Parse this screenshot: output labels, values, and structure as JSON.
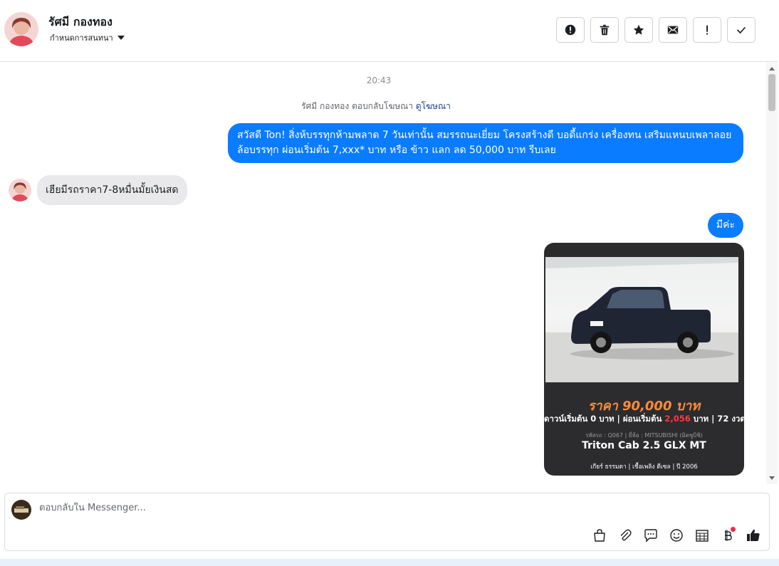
{
  "header": {
    "contact_name": "รัศมี กองทอง",
    "assign_label": "กำหนดการสนทนา",
    "actions": [
      {
        "name": "report",
        "icon": "alert-circle-icon"
      },
      {
        "name": "delete",
        "icon": "trash-icon"
      },
      {
        "name": "star",
        "icon": "star-icon"
      },
      {
        "name": "mark-unread",
        "icon": "envelope-icon"
      },
      {
        "name": "follow-up",
        "icon": "exclamation-icon"
      },
      {
        "name": "done",
        "icon": "check-icon"
      }
    ]
  },
  "chat": {
    "timestamp": "20:43",
    "reply_note": "รัศมี กองทอง ตอบกลับโฆษณา",
    "reply_link": "ดูโฆษณา",
    "messages": [
      {
        "direction": "out",
        "text": "สวัสดี Ton! สิ่งห้บรรทุกห้ามพลาด 7 วันเท่านั้น สมรรถนะเยี่ยม โครงสร้างดี บอดี้แกร่ง เครื่องทน เสริมแหนบเพลาลอย ล้อบรรทุก ผ่อนเริ่มต้น 7,xxx* บาท  หรือ ข้าว แลก ลด 50,000 บาท รีบเลย"
      },
      {
        "direction": "in",
        "text": "เฮียมีรถราคา7-8หมื่นมั้ยเงินสด"
      },
      {
        "direction": "out",
        "text": "มีค่ะ"
      }
    ],
    "ad_image": {
      "price": "ราคา 90,000 บาท",
      "terms_prefix": "ดาวน์เริ่มต้น 0 บาท | ผ่อนเริ่มต้น",
      "terms_amount": "2,056",
      "terms_suffix": "บาท | 72 งวด",
      "meta": "รหัสรถ : Q067 | ยี่ห้อ : MITSUBISHI (มิตซูบิชิ)",
      "model": "Triton Cab 2.5 GLX MT",
      "specs": "เกียร์ ธรรมดา  |  เชื้อเพลิง ดีเซล  |  ปี 2006"
    }
  },
  "composer": {
    "placeholder": "ตอบกลับใน Messenger...",
    "tools": [
      "shopping-bag-icon",
      "paperclip-icon",
      "chat-bubble-icon",
      "smiley-icon",
      "calendar-table-icon",
      "baht-icon",
      "thumbs-up-icon"
    ]
  },
  "colors": {
    "outgoing_bubble": "#0a7cff",
    "incoming_bubble": "#e9e9eb",
    "link": "#1c3e8a",
    "ad_price": "#ff8a3c"
  }
}
